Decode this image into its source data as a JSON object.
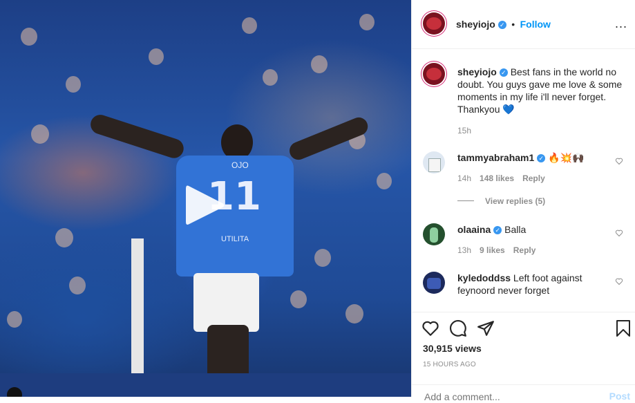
{
  "header": {
    "username": "sheyiojo",
    "separator": "•",
    "follow_label": "Follow",
    "more_label": "..."
  },
  "caption": {
    "username": "sheyiojo",
    "text": "Best fans in the world no doubt. You guys gave me love & some moments in my life i'll never forget. Thankyou 💙",
    "time": "15h"
  },
  "comments": [
    {
      "username": "tammyabraham1",
      "text": "🔥💥🙌🏿",
      "time": "14h",
      "likes": "148 likes",
      "reply_label": "Reply",
      "view_replies": "View replies (5)"
    },
    {
      "username": "olaaina",
      "text": "Balla",
      "time": "13h",
      "likes": "9 likes",
      "reply_label": "Reply"
    },
    {
      "username": "kyledoddss",
      "text": "Left foot against feynoord never forget"
    }
  ],
  "media": {
    "shirt_name": "OJO",
    "shirt_number": "11",
    "sponsor": "UTILITA"
  },
  "stats": {
    "views": "30,915 views",
    "posted": "15 HOURS AGO"
  },
  "add_comment": {
    "placeholder": "Add a comment...",
    "post_label": "Post"
  },
  "colors": {
    "accent": "#0095f6",
    "verified": "#3897f0",
    "muted": "#8e8e8e"
  }
}
